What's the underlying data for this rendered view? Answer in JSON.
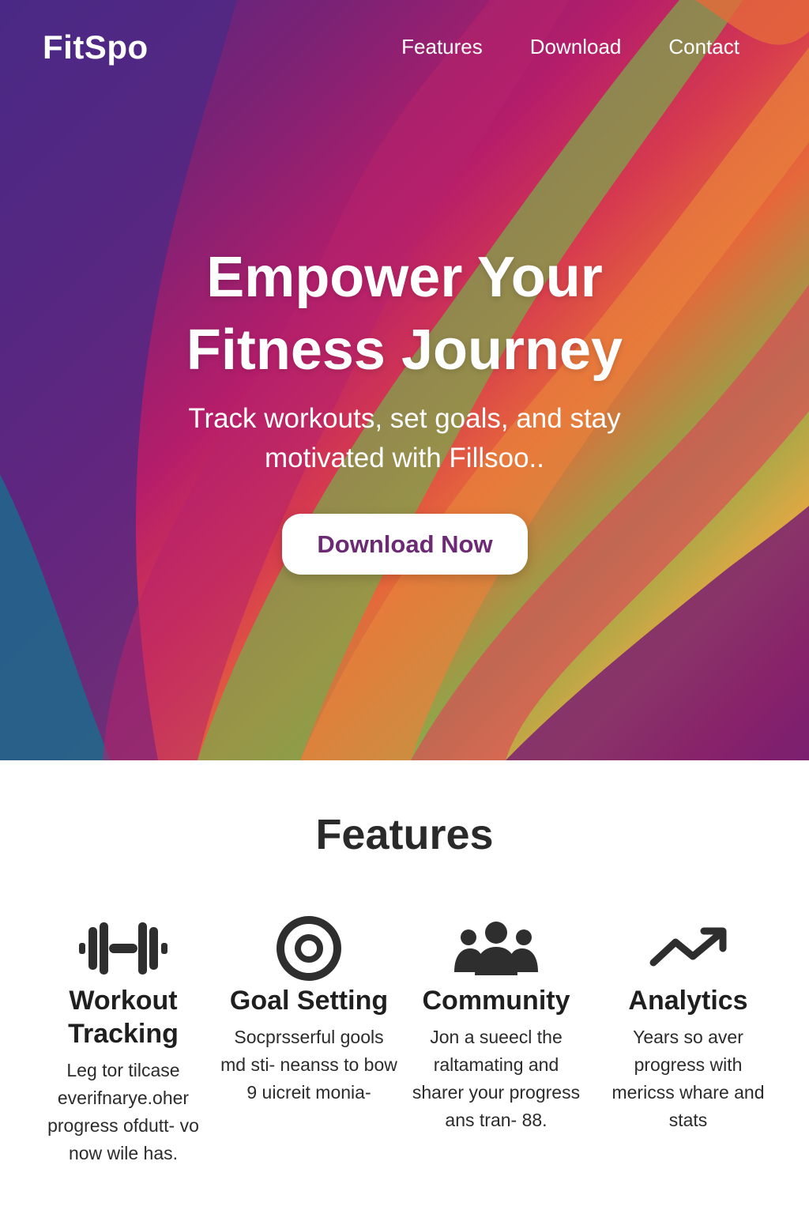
{
  "nav": {
    "logo": "FitSpo",
    "links": [
      "Features",
      "Download",
      "Contact"
    ]
  },
  "hero": {
    "title_line1": "Empower Your",
    "title_line2": "Fitness Journey",
    "subtitle": "Track workouts, set goals, and stay motivated with Fillsoo..",
    "cta_label": "Download Now"
  },
  "features": {
    "heading": "Features",
    "items": [
      {
        "icon": "dumbbell-icon",
        "title": "Workout Tracking",
        "desc": "Leg tor tilcase everifnarye.oher progress ofdutt- vo now wile has."
      },
      {
        "icon": "target-icon",
        "title": "Goal Setting",
        "desc": "Socprsserful gools md sti- neanss to bow 9 uicreit monia-"
      },
      {
        "icon": "users-group-icon",
        "title": "Community",
        "desc": "Jon a sueecl the raltamating and sharer your progress ans tran- 88."
      },
      {
        "icon": "trending-up-icon",
        "title": "Analytics",
        "desc": "Years so aver progress with mericss whare and stats"
      }
    ]
  },
  "colors": {
    "cta_text": "#6b2a73",
    "heading_text": "#2a2a2a"
  }
}
